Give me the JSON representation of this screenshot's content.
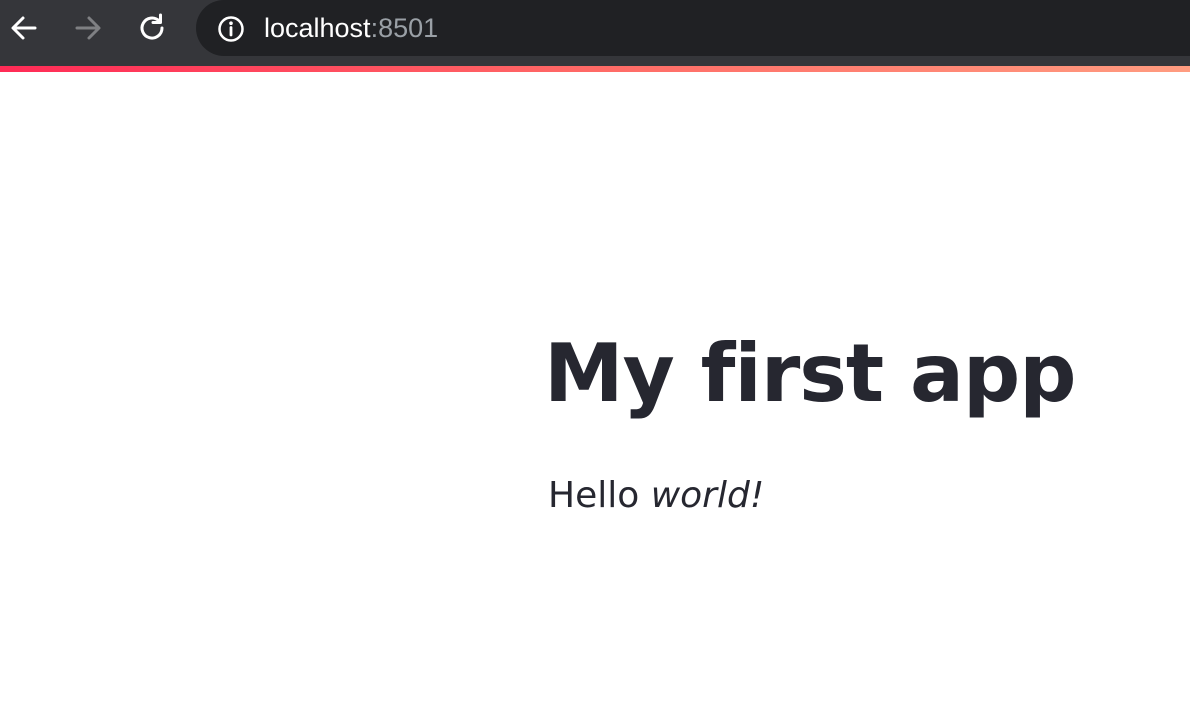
{
  "browser": {
    "url_host": "localhost",
    "url_port": ":8501",
    "icons": {
      "back": "arrow-left-icon",
      "forward": "arrow-right-icon",
      "reload": "reload-icon",
      "site_info": "info-icon"
    },
    "colors": {
      "toolbar": "#35363a",
      "omnibox": "#202124",
      "url_host": "#ffffff",
      "url_port": "#9aa0a6",
      "forward_disabled": "#7f8083"
    }
  },
  "app": {
    "decoration_gradient": [
      "#ff2b56",
      "#ff9c80"
    ],
    "title": "My first app",
    "paragraph": {
      "plain": "Hello ",
      "emphasis": "world!"
    },
    "text_color": "#262730"
  }
}
